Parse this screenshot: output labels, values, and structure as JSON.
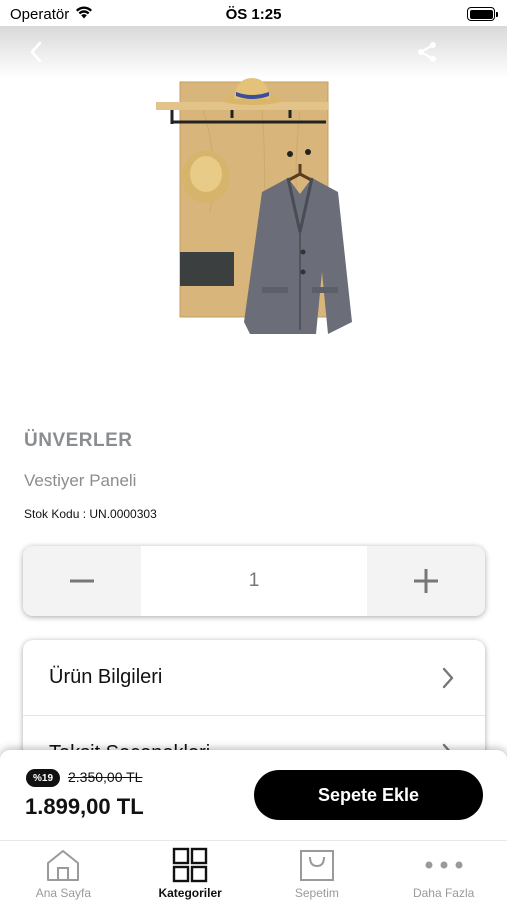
{
  "status_bar": {
    "carrier": "Operatör",
    "time": "ÖS 1:25"
  },
  "product": {
    "brand": "ÜNVERLER",
    "name": "Vestiyer Paneli",
    "stock_code": "Stok Kodu : UN.0000303"
  },
  "quantity": {
    "value": "1"
  },
  "info_sections": [
    {
      "label": "Ürün Bilgileri"
    },
    {
      "label": "Taksit Seçenekleri"
    }
  ],
  "pricing": {
    "discount_badge": "%19",
    "old_price": "2.350,00 TL",
    "new_price": "1.899,00 TL",
    "add_to_cart_label": "Sepete Ekle"
  },
  "tab_bar": {
    "tabs": [
      {
        "label": "Ana Sayfa",
        "icon": "home-icon",
        "active": false
      },
      {
        "label": "Kategoriler",
        "icon": "grid-icon",
        "active": true
      },
      {
        "label": "Sepetim",
        "icon": "shopping-bag-icon",
        "active": false
      },
      {
        "label": "Daha Fazla",
        "icon": "more-dots-icon",
        "active": false
      }
    ]
  },
  "colors": {
    "accent": "#000000",
    "muted_text": "#8a8d91",
    "tab_inactive": "#9a9a9a",
    "wood": "#d8b57a"
  }
}
